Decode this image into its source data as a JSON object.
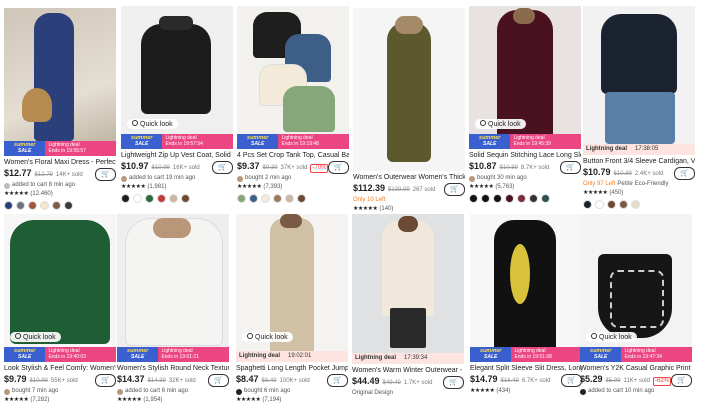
{
  "products": [
    {
      "title": "Women's Floral Maxi Dress - Perfect...",
      "price": "$12.77",
      "orig": "$12.79",
      "sold": "14K+ sold",
      "activity": "added to cart 8 min ago",
      "rating_count": "(12,460)",
      "deal": "Lightning deal",
      "ends": "Ends in 19:55:57",
      "banner": "summer"
    },
    {
      "title": "Lightweight Zip Up Vest Coat, Solid ...",
      "price": "$10.97",
      "orig": "$10.99",
      "sold": "16K+ sold",
      "activity": "added to cart 19 min ago",
      "rating_count": "(1,981)",
      "deal": "Lightning deal",
      "ends": "Ends in 19:57:54",
      "quick_look": "Quick look",
      "banner": "summer"
    },
    {
      "title": "4 Pcs Set Crop Tank Top, Casual Basi...",
      "price": "$9.37",
      "orig": "$9.39",
      "sold": "37K+ sold",
      "off": "-70%",
      "activity": "bought 2 min ago",
      "rating_count": "(7,393)",
      "deal": "Lightning deal",
      "ends": "Ends in 19:19:48",
      "banner": "summer"
    },
    {
      "title": "Women's Outerwear Women's Thick...",
      "price": "$112.39",
      "orig": "$139.99",
      "sold": "267 sold",
      "extra": "Only 10 Left",
      "rating_count": "(140)"
    },
    {
      "title": "Solid Sequin Stitching Lace Long Sle...",
      "price": "$10.87",
      "orig": "$10.89",
      "sold": "8.7K+ sold",
      "activity": "bought 30 min ago",
      "rating_count": "(5,763)",
      "deal": "Lightning deal",
      "ends": "Ends in 19:45:39",
      "quick_look": "Quick look",
      "banner": "summer"
    },
    {
      "title": "Button Front 3/4 Sleeve Cardigan, Vi...",
      "price": "$10.79",
      "orig": "$10.89",
      "sold": "2.4K+ sold",
      "extra": "Only 97 Left",
      "extra2": "Petite",
      "extra3": "Eco-Friendly",
      "rating_count": "(450)",
      "deal": "Lightning deal",
      "ends": "17:38:05",
      "banner": "row"
    },
    {
      "title": "Look Stylish & Feel Comfy: Women's...",
      "price": "$9.79",
      "orig": "$10.99",
      "sold": "55K+ sold",
      "activity": "bought 7 min ago",
      "rating_count": "(7,282)",
      "deal": "Lightning deal",
      "ends": "Ends in 19:40:03",
      "quick_look": "Quick look",
      "banner": "summer"
    },
    {
      "title": "Women's Stylish Round Neck Textur...",
      "price": "$14.37",
      "orig": "$14.39",
      "sold": "32K+ sold",
      "activity": "added to cart 6 min ago",
      "rating_count": "(1,954)",
      "deal": "Lightning deal",
      "ends": "Ends in 19:01:21",
      "banner": "summer"
    },
    {
      "title": "Spaghetti Long Length Pocket Jump...",
      "price": "$8.47",
      "orig": "$8.49",
      "sold": "100K+ sold",
      "activity": "bought 6 min ago",
      "rating_count": "(7,194)",
      "deal": "Lightning deal",
      "ends": "19:02:01",
      "quick_look": "Quick look",
      "banner": "row"
    },
    {
      "title": "Women's Warm Winter Outerwear - ...",
      "price": "$44.49",
      "orig": "$49.49",
      "sold": "1.7K+ sold",
      "extra": "Original Design",
      "deal": "Lightning deal",
      "ends": "17:39:34",
      "banner": "row"
    },
    {
      "title": "Elegant Split Sleeve Slit Dress, Long ...",
      "price": "$14.79",
      "orig": "$16.49",
      "sold": "6.7K+ sold",
      "rating_count": "(434)",
      "deal": "Lightning deal",
      "ends": "Ends in 19:51:08",
      "banner": "summer"
    },
    {
      "title": "Women's Y2K Casual Graphic Print C...",
      "price": "$5.29",
      "orig": "$5.99",
      "sold": "11K+ sold",
      "off": "-62%",
      "activity": "added to cart 10 min ago",
      "deal": "Lightning deal",
      "ends": "Ends in 19:47:34",
      "quick_look": "Quick look",
      "banner": "summer"
    }
  ],
  "labels": {
    "summer": "summer",
    "sale": "SALE",
    "cart": "🛒",
    "stars": "★★★★★"
  },
  "colors": {
    "sale_blue": "#3a5fcf",
    "deal_pink": "#ec4682",
    "deal_row_bg": "#fde4e1",
    "urgency_orange": "#f47c20"
  }
}
